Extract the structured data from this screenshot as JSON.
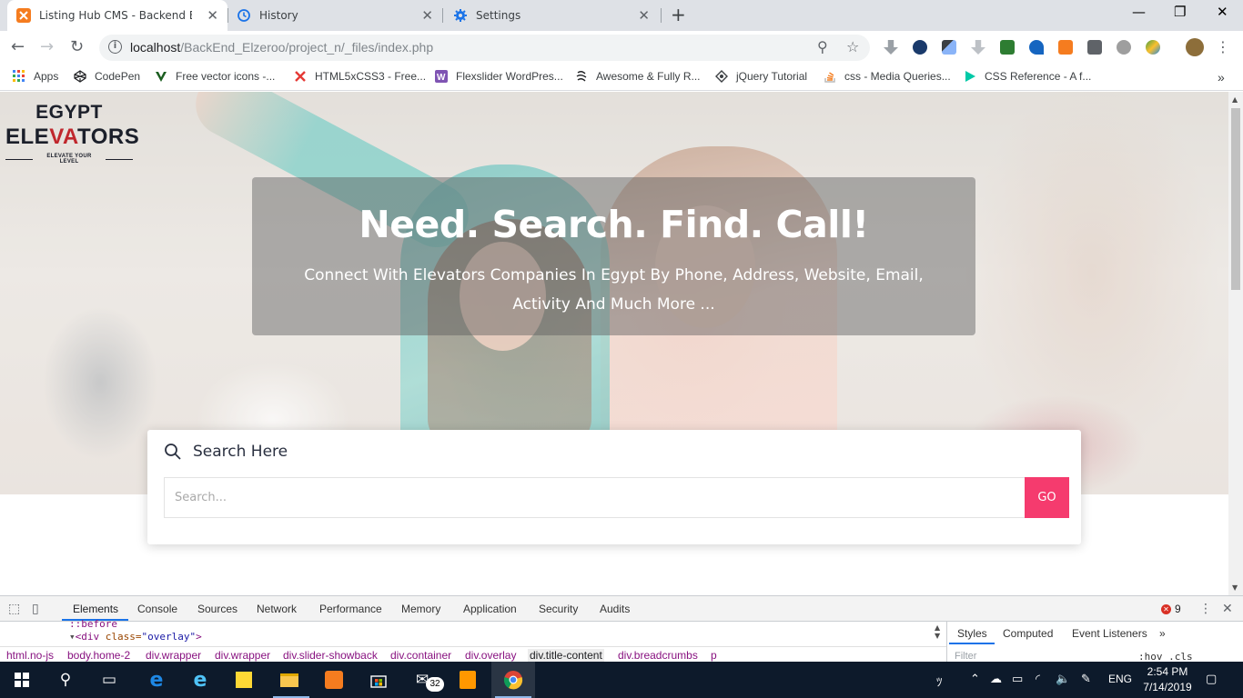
{
  "browser": {
    "tabs": [
      {
        "title": "Listing Hub CMS - Backend Elzer",
        "active": true
      },
      {
        "title": "History",
        "active": false
      },
      {
        "title": "Settings",
        "active": false
      }
    ],
    "url_host": "localhost",
    "url_path": "/BackEnd_Elzeroo/project_n/_files/index.php",
    "bookmarks": [
      "Apps",
      "CodePen",
      "Free vector icons -...",
      "HTML5xCSS3 - Free...",
      "Flexslider WordPres...",
      "Awesome & Fully R...",
      "jQuery Tutorial",
      "css - Media Queries...",
      "CSS Reference - A f..."
    ]
  },
  "page": {
    "logo_line1": "EGYPT",
    "logo_line2_a": "ELE",
    "logo_line2_b": "VA",
    "logo_line2_c": "TORS",
    "logo_tagline": "ELEVATE YOUR LEVEL",
    "hero_title": "Need. Search. Find. Call!",
    "hero_subtitle": "Connect With Elevators Companies In Egypt By Phone, Address, Website, Email, Activity And Much More ...",
    "search_heading": "Search Here",
    "search_placeholder": "Search...",
    "go_label": "GO",
    "accent_color": "#f53b6e"
  },
  "devtools": {
    "tabs": [
      "Elements",
      "Console",
      "Sources",
      "Network",
      "Performance",
      "Memory",
      "Application",
      "Security",
      "Audits"
    ],
    "active_tab": "Elements",
    "error_count": "9",
    "dom_line_1": "::before",
    "dom_line_2_tag": "<div",
    "dom_line_2_attr": " class=",
    "dom_line_2_val": "\"overlay\"",
    "dom_line_2_end": ">",
    "breadcrumbs": [
      "html.no-js",
      "body.home-2",
      "div.wrapper",
      "div.wrapper",
      "div.slider-showback",
      "div.container",
      "div.overlay",
      "div.title-content",
      "div.breadcrumbs",
      "p"
    ],
    "selected_breadcrumb": "div.title-content",
    "side_tabs": [
      "Styles",
      "Computed",
      "Event Listeners"
    ],
    "filter_placeholder": "Filter",
    "hov_cls": ":hov  .cls"
  },
  "taskbar": {
    "mail_badge": "32",
    "language": "ENG",
    "time": "2:54 PM",
    "date": "7/14/2019"
  }
}
